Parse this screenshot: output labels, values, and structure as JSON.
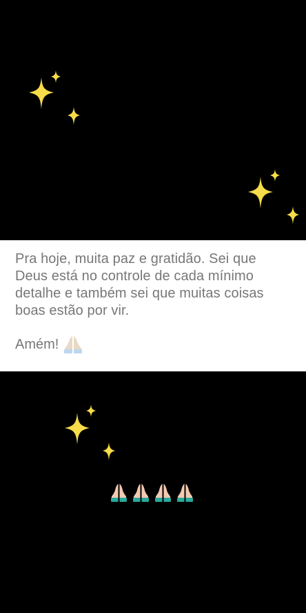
{
  "story": {
    "message": "Pra hoje, muita paz e gratidão. Sei que\nDeus está no controle de cada mínimo\ndetalhe e também sei que muitas coisas\nboas estão por vir.",
    "amen": "Amém!"
  },
  "icons": {
    "sparkles": "sparkles-icon",
    "folded_hands": "folded-hands-icon"
  },
  "colors": {
    "background": "#000000",
    "card": "#ffffff",
    "text": "#777777",
    "sparkle": "#f7dc4a"
  }
}
